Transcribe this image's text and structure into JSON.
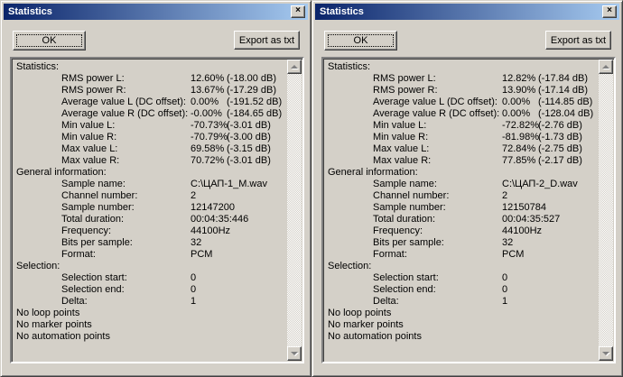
{
  "icons": {
    "close": "×"
  },
  "dialogs": [
    {
      "title": "Statistics",
      "ok_label": "OK",
      "export_label": "Export as txt",
      "rows": [
        {
          "label": "Statistics:",
          "indent": 0
        },
        {
          "label": "RMS power L:",
          "indent": 1,
          "value": "12.60%",
          "db": "(-18.00 dB)"
        },
        {
          "label": "RMS power R:",
          "indent": 1,
          "value": "13.67%",
          "db": "(-17.29 dB)"
        },
        {
          "label": "Average value L (DC offset):",
          "indent": 1,
          "value": "0.00%",
          "db": "(-191.52 dB)"
        },
        {
          "label": "Average value R (DC offset):",
          "indent": 1,
          "value": "-0.00%",
          "db": "(-184.65 dB)"
        },
        {
          "label": "Min value L:",
          "indent": 1,
          "value": "-70.73%",
          "db": "(-3.01 dB)"
        },
        {
          "label": "Min value R:",
          "indent": 1,
          "value": "-70.79%",
          "db": "(-3.00 dB)"
        },
        {
          "label": "Max value L:",
          "indent": 1,
          "value": "69.58%",
          "db": "(-3.15 dB)"
        },
        {
          "label": "Max value R:",
          "indent": 1,
          "value": "70.72%",
          "db": "(-3.01 dB)"
        },
        {
          "label": "General information:",
          "indent": 0
        },
        {
          "label": "Sample name:",
          "indent": 1,
          "value": "C:\\ЦАП-1_M.wav"
        },
        {
          "label": "Channel number:",
          "indent": 1,
          "value": "2"
        },
        {
          "label": "Sample number:",
          "indent": 1,
          "value": "12147200"
        },
        {
          "label": "Total duration:",
          "indent": 1,
          "value": "00:04:35:446"
        },
        {
          "label": "Frequency:",
          "indent": 1,
          "value": "44100Hz"
        },
        {
          "label": "Bits per sample:",
          "indent": 1,
          "value": "32"
        },
        {
          "label": "Format:",
          "indent": 1,
          "value": "PCM"
        },
        {
          "label": "Selection:",
          "indent": 0
        },
        {
          "label": "Selection start:",
          "indent": 1,
          "value": "0"
        },
        {
          "label": "Selection end:",
          "indent": 1,
          "value": "0"
        },
        {
          "label": "Delta:",
          "indent": 1,
          "value": "1"
        },
        {
          "label": "No loop points",
          "indent": 0
        },
        {
          "label": "No marker points",
          "indent": 0
        },
        {
          "label": "No automation points",
          "indent": 0
        }
      ]
    },
    {
      "title": "Statistics",
      "ok_label": "OK",
      "export_label": "Export as txt",
      "rows": [
        {
          "label": "Statistics:",
          "indent": 0
        },
        {
          "label": "RMS power L:",
          "indent": 1,
          "value": "12.82%",
          "db": "(-17.84 dB)"
        },
        {
          "label": "RMS power R:",
          "indent": 1,
          "value": "13.90%",
          "db": "(-17.14 dB)"
        },
        {
          "label": "Average value L (DC offset):",
          "indent": 1,
          "value": "0.00%",
          "db": "(-114.85 dB)"
        },
        {
          "label": "Average value R (DC offset):",
          "indent": 1,
          "value": "0.00%",
          "db": "(-128.04 dB)"
        },
        {
          "label": "Min value L:",
          "indent": 1,
          "value": "-72.82%",
          "db": "(-2.76 dB)"
        },
        {
          "label": "Min value R:",
          "indent": 1,
          "value": "-81.98%",
          "db": "(-1.73 dB)"
        },
        {
          "label": "Max value L:",
          "indent": 1,
          "value": "72.84%",
          "db": "(-2.75 dB)"
        },
        {
          "label": "Max value R:",
          "indent": 1,
          "value": "77.85%",
          "db": "(-2.17 dB)"
        },
        {
          "label": "General information:",
          "indent": 0
        },
        {
          "label": "Sample name:",
          "indent": 1,
          "value": "C:\\ЦАП-2_D.wav"
        },
        {
          "label": "Channel number:",
          "indent": 1,
          "value": "2"
        },
        {
          "label": "Sample number:",
          "indent": 1,
          "value": "12150784"
        },
        {
          "label": "Total duration:",
          "indent": 1,
          "value": "00:04:35:527"
        },
        {
          "label": "Frequency:",
          "indent": 1,
          "value": "44100Hz"
        },
        {
          "label": "Bits per sample:",
          "indent": 1,
          "value": "32"
        },
        {
          "label": "Format:",
          "indent": 1,
          "value": "PCM"
        },
        {
          "label": "Selection:",
          "indent": 0
        },
        {
          "label": "Selection start:",
          "indent": 1,
          "value": "0"
        },
        {
          "label": "Selection end:",
          "indent": 1,
          "value": "0"
        },
        {
          "label": "Delta:",
          "indent": 1,
          "value": "1"
        },
        {
          "label": "No loop points",
          "indent": 0
        },
        {
          "label": "No marker points",
          "indent": 0
        },
        {
          "label": "No automation points",
          "indent": 0
        }
      ]
    }
  ]
}
